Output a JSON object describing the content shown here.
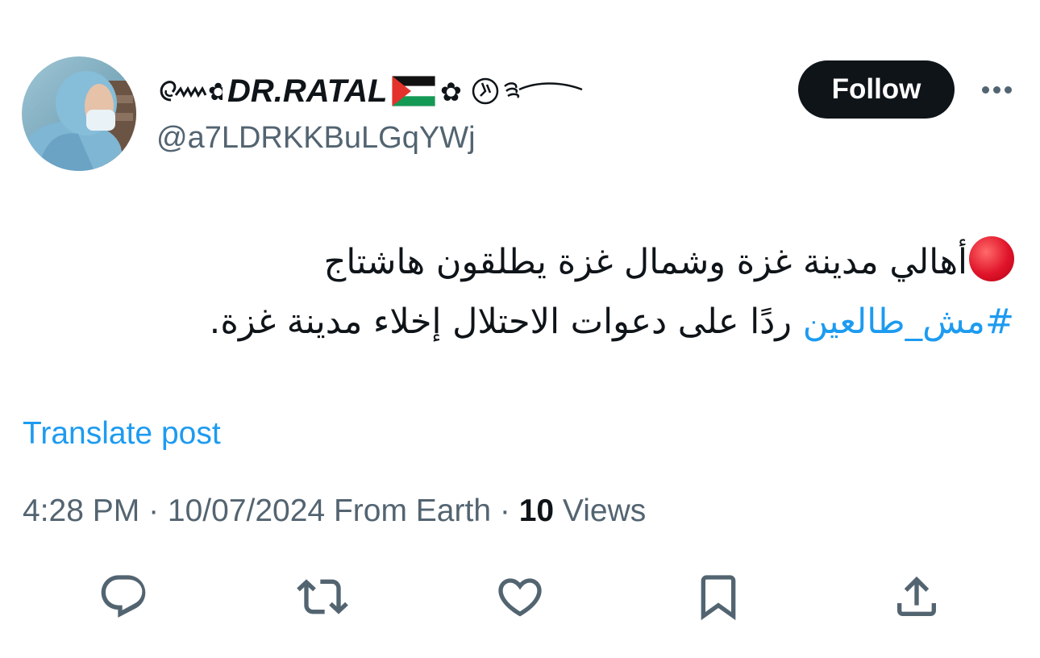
{
  "author": {
    "display_name_text": "DR.RATAL",
    "handle": "@a7LDRKKBuLGqYWj",
    "avatar_icon": "avatar-photo",
    "flag_icon": "palestine-flag"
  },
  "header": {
    "follow_label": "Follow",
    "more_icon": "more-horizontal-icon"
  },
  "tweet": {
    "emoji_icon": "red-circle",
    "line1_text": "أهالي مدينة غزة وشمال غزة يطلقون هاشتاج",
    "hashtag": "#مش_طالعين",
    "line2_text": " ردًا على دعوات الاحتلال إخلاء مدينة غزة."
  },
  "translate_label": "Translate post",
  "meta": {
    "time": "4:28 PM",
    "separator": " · ",
    "date": "10/07/2024",
    "source": "From Earth",
    "views_count": "10",
    "views_label": "Views"
  },
  "actions": [
    {
      "icon": "reply-icon"
    },
    {
      "icon": "repost-icon"
    },
    {
      "icon": "like-icon"
    },
    {
      "icon": "bookmark-icon"
    },
    {
      "icon": "share-icon"
    }
  ],
  "colors": {
    "accent": "#1d9bf0",
    "text": "#0f1419",
    "secondary": "#536471",
    "follow_bg": "#0f1419"
  }
}
